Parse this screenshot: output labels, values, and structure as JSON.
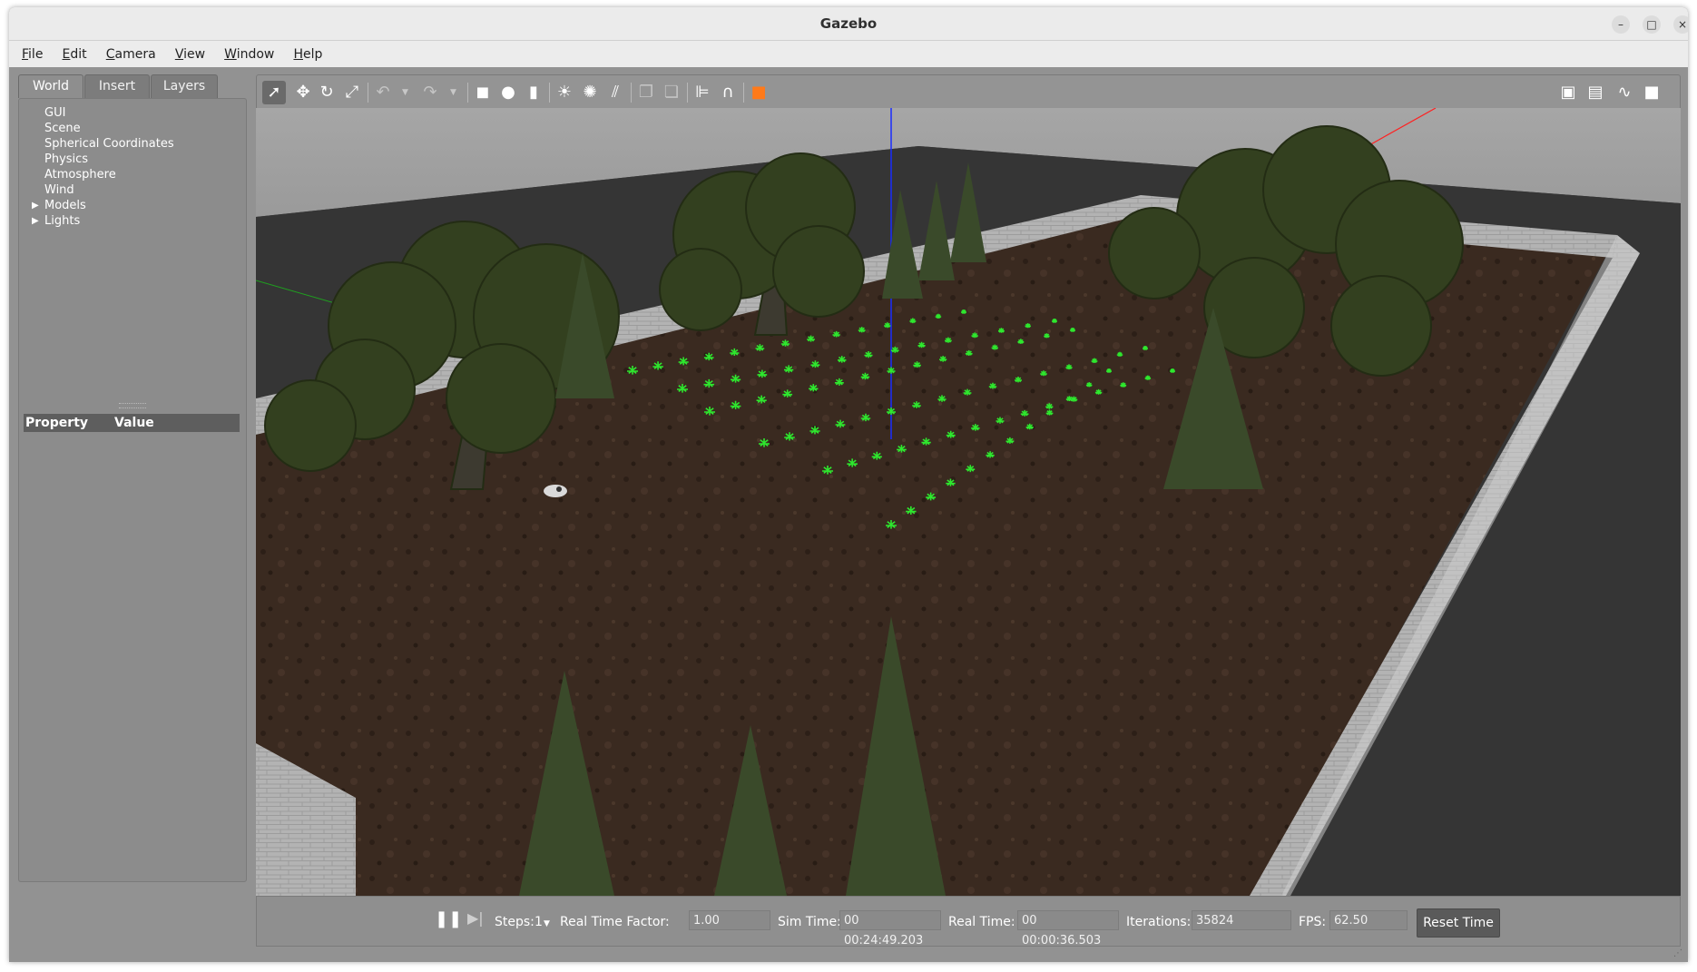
{
  "window": {
    "title": "Gazebo"
  },
  "menu": [
    "File",
    "Edit",
    "Camera",
    "View",
    "Window",
    "Help"
  ],
  "left_panel": {
    "tabs": [
      "World",
      "Insert",
      "Layers"
    ],
    "active_tab": "World",
    "tree": [
      "GUI",
      "Scene",
      "Spherical Coordinates",
      "Physics",
      "Atmosphere",
      "Wind"
    ],
    "tree_expandable": [
      "Models",
      "Lights"
    ],
    "property_header": {
      "property": "Property",
      "value": "Value"
    }
  },
  "toolbar": {
    "tools": [
      "select-mode",
      "translate-mode",
      "rotate-mode",
      "scale-mode",
      "undo",
      "redo",
      "box",
      "sphere",
      "cylinder",
      "point-light",
      "spot-light",
      "directional-light",
      "copy",
      "paste",
      "align",
      "snap",
      "view-angle"
    ],
    "right_tools": [
      "screenshot",
      "log",
      "plot",
      "record-video"
    ]
  },
  "bottom_bar": {
    "steps_label": "Steps:",
    "steps_value": "1",
    "rtf_label": "Real Time Factor:",
    "rtf_value": "1.00",
    "sim_time_label": "Sim Time:",
    "sim_time_value": "00 00:24:49.203",
    "real_time_label": "Real Time:",
    "real_time_value": "00 00:00:36.503",
    "iterations_label": "Iterations:",
    "iterations_value": "35824",
    "fps_label": "FPS:",
    "fps_value": "62.50",
    "reset_label": "Reset Time"
  },
  "colors": {
    "panel_bg": "#929292",
    "viewport_bg": "#3a3a3a",
    "soil": "#3b2a20",
    "wall": "#b8b8b8",
    "plant": "#2ee82e",
    "tree": "#34401f"
  }
}
